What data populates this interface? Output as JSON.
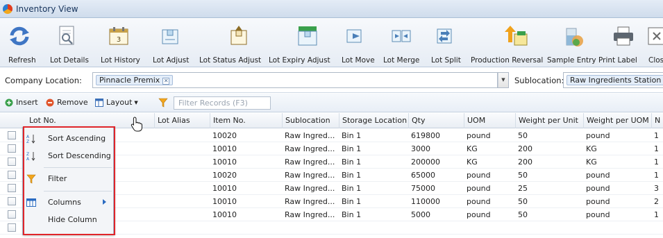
{
  "window": {
    "title": "Inventory View"
  },
  "toolbar": {
    "buttons": [
      {
        "label": "Refresh",
        "icon": "refresh-icon"
      },
      {
        "label": "Lot Details",
        "icon": "document-icon"
      },
      {
        "label": "Lot History",
        "icon": "calendar-icon"
      },
      {
        "label": "Lot Adjust",
        "icon": "box-adjust-icon"
      },
      {
        "label": "Lot Status Adjust",
        "icon": "box-status-icon"
      },
      {
        "label": "Lot Expiry Adjust",
        "icon": "box-expiry-icon"
      },
      {
        "label": "Lot Move",
        "icon": "box-move-icon"
      },
      {
        "label": "Lot Merge",
        "icon": "box-merge-icon"
      },
      {
        "label": "Lot Split",
        "icon": "box-split-icon"
      },
      {
        "label": "Production Reversal",
        "icon": "production-reversal-icon"
      },
      {
        "label": "Sample Entry",
        "icon": "beaker-icon"
      },
      {
        "label": "Print Label",
        "icon": "printer-icon"
      },
      {
        "label": "Clos",
        "icon": "close-icon"
      }
    ]
  },
  "location": {
    "company_label": "Company Location:",
    "company_value": "Pinnacle Premix",
    "sublocation_label": "Sublocation:",
    "sublocation_value": "Raw Ingredients Station"
  },
  "grid_toolbar": {
    "insert": "Insert",
    "remove": "Remove",
    "layout": "Layout",
    "filter_placeholder": "Filter Records (F3)"
  },
  "columns": [
    "Lot No.",
    "Lot Alias",
    "Item No.",
    "Sublocation",
    "Storage Location",
    "Qty",
    "UOM",
    "Weight per Unit",
    "Weight per UOM",
    "N"
  ],
  "rows": [
    {
      "item": "10020",
      "sub": "Raw Ingred...",
      "storage": "Bin 1",
      "qty": "619800",
      "uom": "pound",
      "wpu": "50",
      "wpuom": "pound",
      "n": "1"
    },
    {
      "item": "10010",
      "sub": "Raw Ingred...",
      "storage": "Bin 1",
      "qty": "3000",
      "uom": "KG",
      "wpu": "200",
      "wpuom": "KG",
      "n": "1"
    },
    {
      "item": "10010",
      "sub": "Raw Ingred...",
      "storage": "Bin 1",
      "qty": "200000",
      "uom": "KG",
      "wpu": "200",
      "wpuom": "KG",
      "n": "1"
    },
    {
      "item": "10020",
      "sub": "Raw Ingred...",
      "storage": "Bin 1",
      "qty": "65000",
      "uom": "pound",
      "wpu": "50",
      "wpuom": "pound",
      "n": "1"
    },
    {
      "item": "10010",
      "sub": "Raw Ingred...",
      "storage": "Bin 1",
      "qty": "75000",
      "uom": "pound",
      "wpu": "25",
      "wpuom": "pound",
      "n": "3"
    },
    {
      "item": "10010",
      "sub": "Raw Ingred...",
      "storage": "Bin 1",
      "qty": "110000",
      "uom": "pound",
      "wpu": "50",
      "wpuom": "pound",
      "n": "2"
    },
    {
      "item": "10010",
      "sub": "Raw Ingred...",
      "storage": "Bin 1",
      "qty": "5000",
      "uom": "pound",
      "wpu": "50",
      "wpuom": "pound",
      "n": "1"
    }
  ],
  "context_menu": {
    "sort_asc": "Sort Ascending",
    "sort_desc": "Sort Descending",
    "filter": "Filter",
    "columns": "Columns",
    "hide_column": "Hide Column"
  },
  "colors": {
    "accent": "#2a6bc1",
    "highlight_outline": "#e0252a"
  }
}
